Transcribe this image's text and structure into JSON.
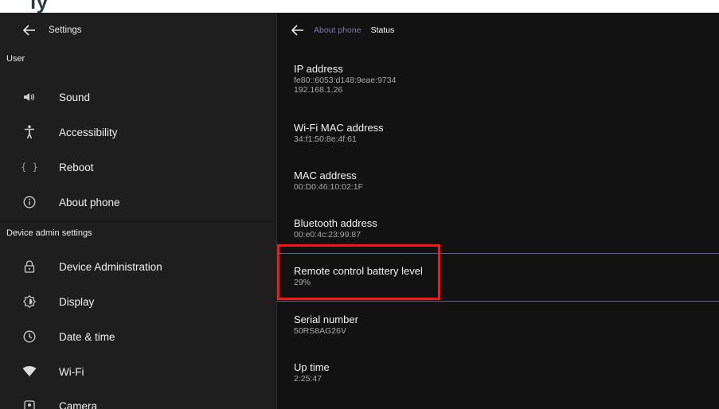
{
  "left_panel": {
    "back_icon": "arrow-left-icon",
    "title": "Settings",
    "section_user": "User",
    "items_user": [
      {
        "icon": "volume-icon",
        "label": "Sound"
      },
      {
        "icon": "accessibility-icon",
        "label": "Accessibility"
      },
      {
        "icon": "braces-icon",
        "label": "Reboot"
      },
      {
        "icon": "info-icon",
        "label": "About phone"
      }
    ],
    "section_admin": "Device admin settings",
    "items_admin": [
      {
        "icon": "lock-icon",
        "label": "Device Administration"
      },
      {
        "icon": "brightness-icon",
        "label": "Display"
      },
      {
        "icon": "clock-icon",
        "label": "Date & time"
      },
      {
        "icon": "wifi-icon",
        "label": "Wi-Fi"
      },
      {
        "icon": "camera-icon",
        "label": "Camera"
      }
    ]
  },
  "right_panel": {
    "back_icon": "arrow-left-icon",
    "breadcrumb_parent": "About phone",
    "breadcrumb_current": "Status",
    "items": [
      {
        "title": "IP address",
        "value": "fe80::6053:d148:9eae:9734",
        "value2": "192.168.1.26"
      },
      {
        "title": "Wi-Fi MAC address",
        "value": "34:f1:50:8e:4f:61"
      },
      {
        "title": "MAC address",
        "value": "00:D0:46:10:02:1F"
      },
      {
        "title": "Bluetooth address",
        "value": "00:e0:4c:23:99:87"
      },
      {
        "title": "Remote control battery level",
        "value": "29%"
      },
      {
        "title": "Serial number",
        "value": "50RS8AG26V"
      },
      {
        "title": "Up time",
        "value": "2:25:47"
      }
    ]
  },
  "colors": {
    "left_bg": "#1e1e1e",
    "right_bg": "#121212",
    "breadcrumb_parent": "#7a7aa8",
    "focus_line": "#5f5f9a",
    "highlight_box": "#ff1414"
  }
}
